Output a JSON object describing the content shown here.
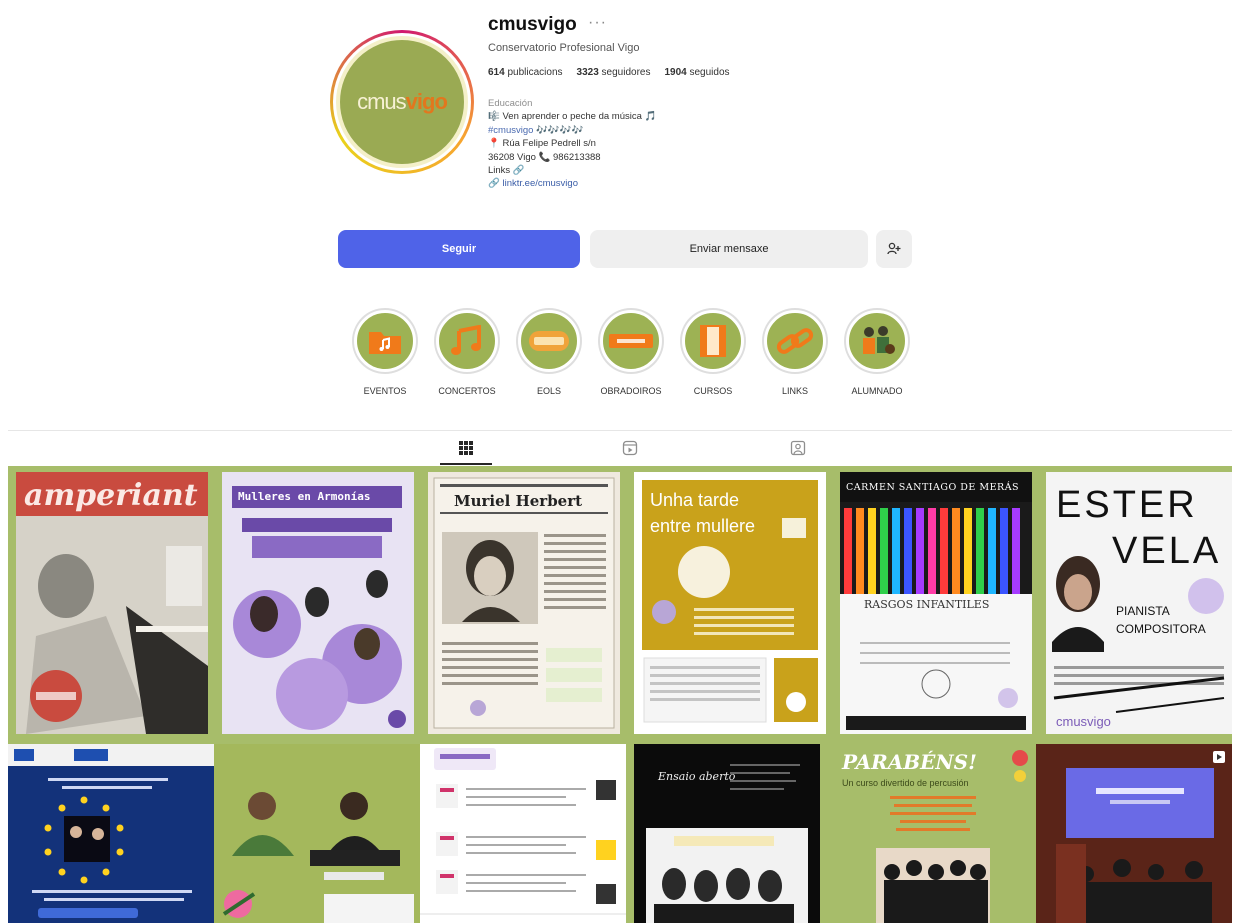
{
  "profile": {
    "username": "cmusvigo",
    "more_dots": "···",
    "full_name": "Conservatorio Profesional Vigo",
    "avatar_logo_a": "cmus",
    "avatar_logo_b": "vigo",
    "stats": {
      "posts": "614",
      "posts_label": "publicacions",
      "followers": "3323",
      "followers_label": "seguidores",
      "following": "1904",
      "following_label": "seguidos"
    },
    "bio": {
      "category": "Educación",
      "line1": "🎼 Ven aprender o peche da música 🎵",
      "hashtag": "#cmusvigo 🎶🎶🎶🎶",
      "line3": "📍 Rúa Felipe Pedrell s/n",
      "line4": "36208 Vigo 📞 986213388",
      "line5": "Links 🔗",
      "link": "linktr.ee/cmusvigo"
    },
    "follow_label": "Seguir",
    "message_label": "Enviar mensaxe"
  },
  "highlights": [
    {
      "label": "EVENTOS",
      "icon": "folder-music-icon"
    },
    {
      "label": "CONCERTOS",
      "icon": "music-notes-icon"
    },
    {
      "label": "EOLS",
      "icon": "logo-badge-icon"
    },
    {
      "label": "OBRADOIROS",
      "icon": "banner-icon"
    },
    {
      "label": "CURSOS",
      "icon": "book-icon"
    },
    {
      "label": "LINKS",
      "icon": "chain-link-icon"
    },
    {
      "label": "ALUMNADO",
      "icon": "students-icon"
    }
  ],
  "tabs": [
    "posts-grid-icon",
    "reels-icon",
    "tagged-icon"
  ],
  "posts": {
    "p1_title": "amperiant",
    "p2_title": "Mulleres en Armonías",
    "p3_title": "Muriel Herbert",
    "p4_title_a": "Unha tarde",
    "p4_title_b": "entre mullere",
    "p5_title": "CARMEN SANTIAGO DE MERÁS",
    "p5_sub": "RASGOS INFANTILES",
    "p6_title_a": "ESTER",
    "p6_title_b": "VELA",
    "p6_sub_a": "PIANISTA",
    "p6_sub_b": "COMPOSITORA",
    "p6_footer": "cmusvigo",
    "p10_title": "Ensaio aberto",
    "p11_title": "PARABÉNS!",
    "p11_sub": "Un curso divertido de percusión"
  },
  "colors": {
    "accent": "#4f63e8",
    "brand_green": "#9db254",
    "grid_border": "#a7bd6a",
    "mustard": "#c9a21b",
    "purple": "#7c5cb8"
  }
}
